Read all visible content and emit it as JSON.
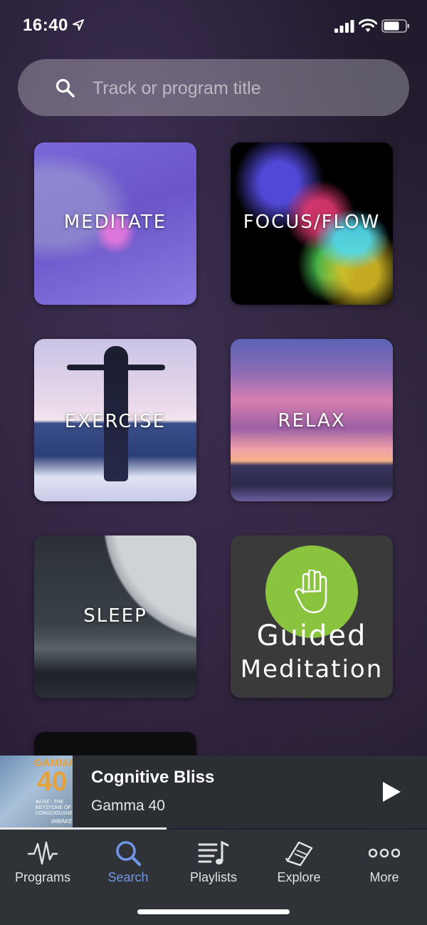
{
  "status_bar": {
    "time": "16:40"
  },
  "search": {
    "placeholder": "Track or program title"
  },
  "categories": [
    {
      "label": "MEDITATE"
    },
    {
      "label": "FOCUS/FLOW"
    },
    {
      "label": "EXERCISE"
    },
    {
      "label": "RELAX"
    },
    {
      "label": "SLEEP"
    },
    {
      "label_line1": "Guided",
      "label_line2": "Meditation"
    }
  ],
  "now_playing": {
    "title": "Cognitive Bliss",
    "subtitle": "Gamma 40",
    "cover_text": {
      "top": "GAMMA",
      "number": "40",
      "tagline": "40 HZ - THE KEYSTONE OF CONSCIOUSNESS",
      "brand": "iAWAKE"
    },
    "progress": 0.39
  },
  "tabs": [
    {
      "label": "Programs",
      "icon": "waveform-icon"
    },
    {
      "label": "Search",
      "icon": "search-icon",
      "active": true
    },
    {
      "label": "Playlists",
      "icon": "playlist-icon"
    },
    {
      "label": "Explore",
      "icon": "book-icon"
    },
    {
      "label": "More",
      "icon": "more-icon"
    }
  ],
  "colors": {
    "active_tab": "#6f97e6",
    "guided_circle": "#8ac43f",
    "player_bg": "#2b2e32",
    "tabbar_bg": "#2f3236"
  }
}
